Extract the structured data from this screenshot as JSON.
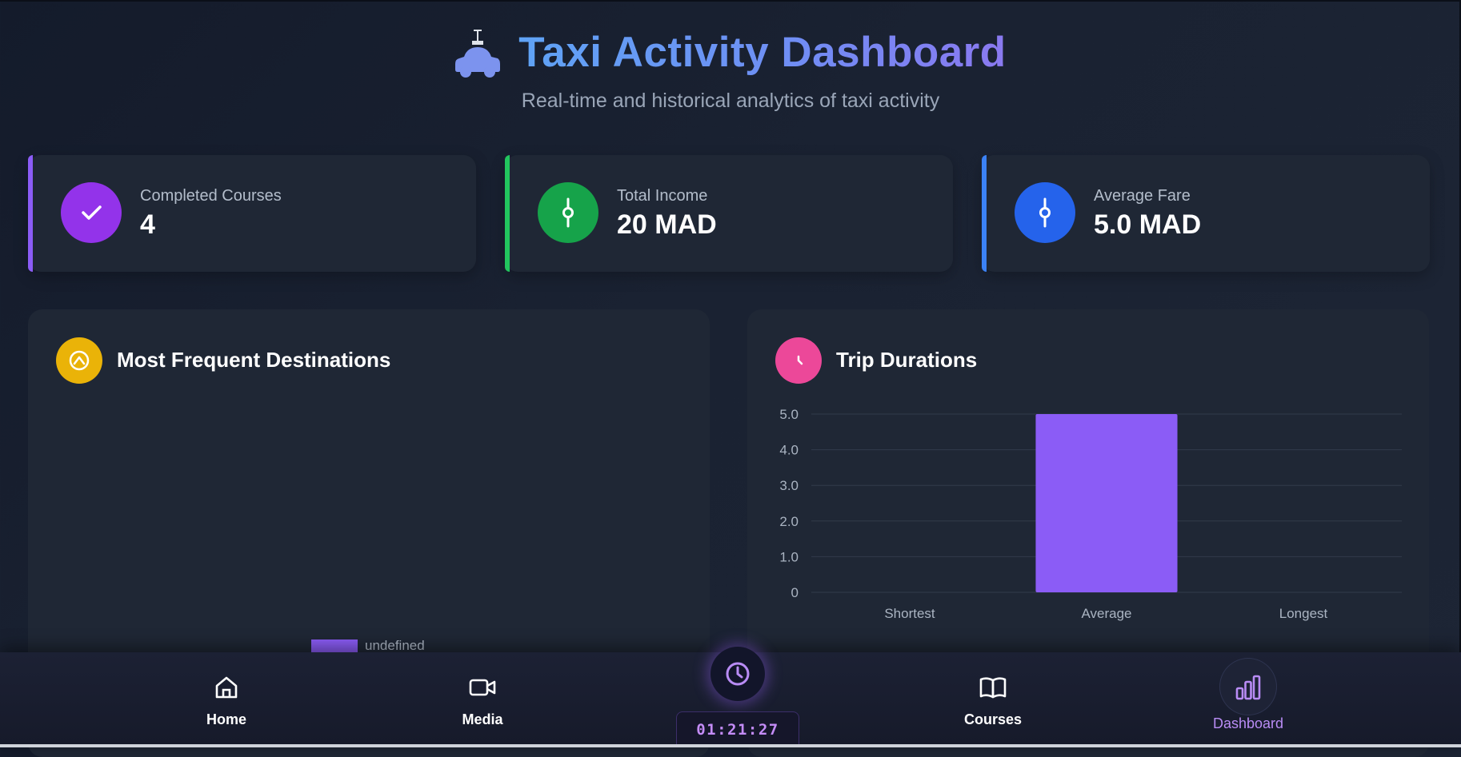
{
  "header": {
    "title": "Taxi Activity Dashboard",
    "subtitle": "Real-time and historical analytics of taxi activity",
    "icon": "taxi-icon"
  },
  "stats": [
    {
      "label": "Completed Courses",
      "value": "4",
      "icon": "check-icon",
      "color": "#9333ea"
    },
    {
      "label": "Total Income",
      "value": "20 MAD",
      "icon": "commit-icon",
      "color": "#16a34a"
    },
    {
      "label": "Average Fare",
      "value": "5.0 MAD",
      "icon": "commit-icon",
      "color": "#2563eb"
    }
  ],
  "panels": {
    "destinations": {
      "title": "Most Frequent Destinations",
      "icon": "map-pin-icon",
      "icon_color": "#eab308",
      "legend_label": "undefined"
    },
    "durations": {
      "title": "Trip Durations",
      "icon": "clock-icon",
      "icon_color": "#ec4899"
    }
  },
  "chart_data": {
    "type": "bar",
    "title": "Trip Durations",
    "categories": [
      "Shortest",
      "Average",
      "Longest"
    ],
    "values": [
      0,
      5.0,
      0
    ],
    "yticks": [
      "0",
      "1.0",
      "2.0",
      "3.0",
      "4.0",
      "5.0"
    ],
    "ylim": [
      0,
      5
    ],
    "grid": true,
    "bar_color": "#8b5cf6"
  },
  "nav": {
    "items": [
      {
        "label": "Home",
        "icon": "home-icon"
      },
      {
        "label": "Media",
        "icon": "video-icon"
      },
      {
        "label": "Courses",
        "icon": "book-icon"
      },
      {
        "label": "Dashboard",
        "icon": "bar-chart-icon",
        "active": true
      }
    ],
    "timer": "01:21:27",
    "center_icon": "clock-icon"
  },
  "colors": {
    "background": "#161d2b",
    "card": "#1f2735",
    "accent_purple": "#8b5cf6",
    "active_nav": "#b98cf5"
  }
}
